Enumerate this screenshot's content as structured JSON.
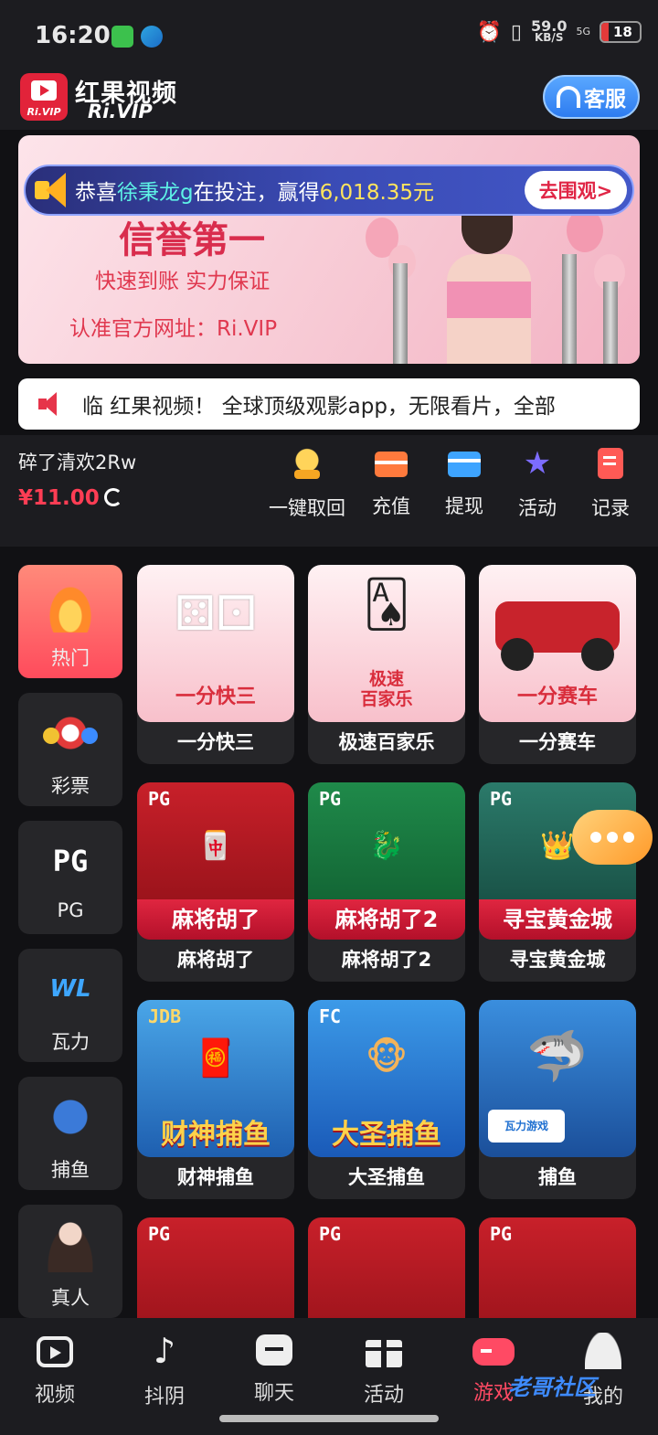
{
  "status": {
    "time": "16:20",
    "speed_value": "59.0",
    "speed_unit": "KB/S",
    "network": "5G",
    "battery": "18"
  },
  "header": {
    "title": "红果视频",
    "subtitle": "Ri.VIP",
    "logo_badge": "Ri.VIP",
    "service_label": "客服"
  },
  "banner": {
    "notice_prefix": "恭喜",
    "notice_user": "徐秉龙g",
    "notice_mid": "在投注，赢得",
    "notice_amount": "6,018.35元",
    "notice_button": "去围观>",
    "slogan_main": "信誉第一",
    "slogan_sub": "快速到账 实力保证",
    "slogan_url": "认准官方网址：Ri.VIP"
  },
  "marquee": {
    "text": "临 红果视频！ 全球顶级观影app，无限看片，全部"
  },
  "user": {
    "name": "碎了清欢2Rw",
    "balance": "¥11.00"
  },
  "actions": [
    {
      "label": "一键取回",
      "icon": "coin-hand-icon"
    },
    {
      "label": "充值",
      "icon": "wallet-icon"
    },
    {
      "label": "提现",
      "icon": "card-icon"
    },
    {
      "label": "活动",
      "icon": "star-icon"
    },
    {
      "label": "记录",
      "icon": "record-icon"
    }
  ],
  "categories": [
    {
      "label": "热门",
      "icon": "fire-icon",
      "active": true
    },
    {
      "label": "彩票",
      "icon": "lottery-ball-icon"
    },
    {
      "label": "PG",
      "icon": "pg-logo-icon",
      "glyph": "PG"
    },
    {
      "label": "瓦力",
      "icon": "wali-logo-icon",
      "glyph": "WL"
    },
    {
      "label": "捕鱼",
      "icon": "fish-icon"
    },
    {
      "label": "真人",
      "icon": "live-dealer-icon"
    }
  ],
  "games": [
    {
      "label": "一分快三",
      "caption": "一分快三"
    },
    {
      "label": "极速百家乐",
      "caption": "极速\n百家乐"
    },
    {
      "label": "一分赛车",
      "caption": "一分赛车"
    },
    {
      "label": "麻将胡了",
      "caption": "麻将胡了",
      "badge": "PG"
    },
    {
      "label": "麻将胡了2",
      "caption": "麻将胡了2",
      "badge": "PG"
    },
    {
      "label": "寻宝黄金城",
      "caption": "寻宝黄金城",
      "badge": "PG"
    },
    {
      "label": "财神捕鱼",
      "caption": "财神捕鱼",
      "badge": "JDB"
    },
    {
      "label": "大圣捕鱼",
      "caption": "大圣捕鱼",
      "badge": "FC"
    },
    {
      "label": "捕鱼",
      "caption": "瓦力游戏"
    },
    {
      "label": "",
      "badge": "PG"
    },
    {
      "label": "",
      "badge": "PG"
    },
    {
      "label": "",
      "badge": "PG"
    }
  ],
  "nav": [
    {
      "label": "视频",
      "icon": "tv-icon"
    },
    {
      "label": "抖阴",
      "icon": "music-note-icon"
    },
    {
      "label": "聊天",
      "icon": "chat-icon"
    },
    {
      "label": "活动",
      "icon": "gift-icon"
    },
    {
      "label": "游戏",
      "icon": "gamepad-icon",
      "active": true
    },
    {
      "label": "我的",
      "icon": "user-icon"
    }
  ],
  "watermark": "老哥社区",
  "colors": {
    "accent": "#ff3d54",
    "service_blue": "#2d7cf0",
    "bg": "#111114"
  }
}
